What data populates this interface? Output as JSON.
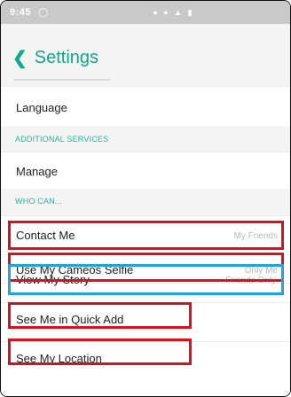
{
  "status_bar": {
    "time": "9:45",
    "app_icon": "snapchat-ghost-icon",
    "icons": "signal wifi battery"
  },
  "header": {
    "back_glyph": "<",
    "title": "Settings"
  },
  "rows": {
    "language": "Language",
    "manage": "Manage",
    "contact_me": {
      "label": "Contact Me",
      "value": "My Friends"
    },
    "use_cameos_selfie": {
      "label": "Use My Cameos Selfie",
      "value": "Only Me"
    },
    "view_my_story": {
      "label": "View My Story",
      "value": "Friends Only"
    },
    "see_me_quick_add": "See Me in Quick Add",
    "see_my_location": "See My Location"
  },
  "sections": {
    "additional_services": "ADDITIONAL SERVICES",
    "who_can": "WHO CAN..."
  },
  "colors": {
    "accent": "#0fa88a",
    "highlight_red": "#d9111f",
    "highlight_blue": "#21a3dd"
  }
}
